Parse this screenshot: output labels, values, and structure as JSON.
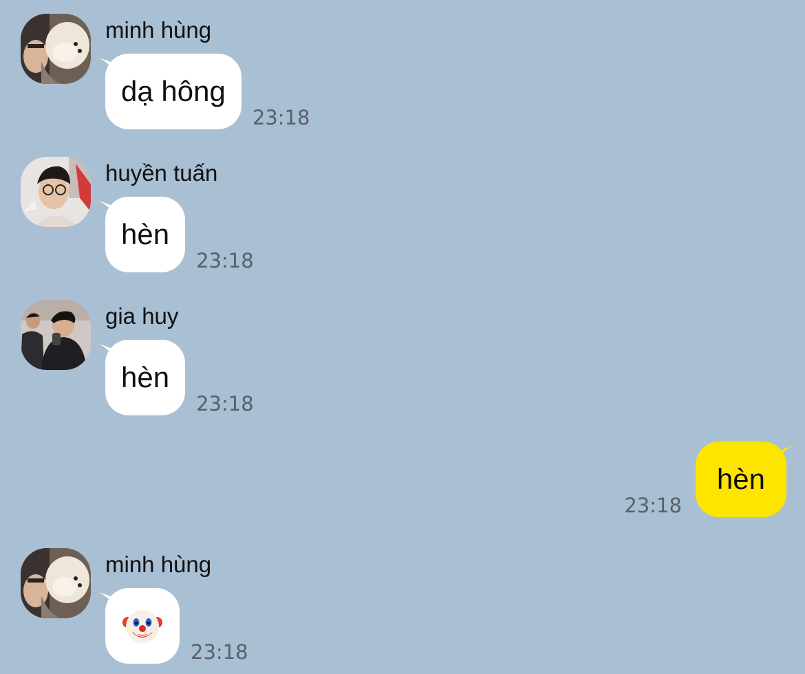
{
  "colors": {
    "background": "#a9bfd3",
    "incoming_bubble": "#ffffff",
    "outgoing_bubble": "#fee500",
    "timestamp": "#59606a"
  },
  "messages": [
    {
      "direction": "incoming",
      "sender": "minh hùng",
      "text": "dạ hông",
      "time": "23:18"
    },
    {
      "direction": "incoming",
      "sender": "huyền tuấn",
      "text": "hèn",
      "time": "23:18"
    },
    {
      "direction": "incoming",
      "sender": "gia huy",
      "text": "hèn",
      "time": "23:18"
    },
    {
      "direction": "outgoing",
      "text": "hèn",
      "time": "23:18"
    },
    {
      "direction": "incoming",
      "sender": "minh hùng",
      "emoji": "clown-face",
      "time": "23:18"
    }
  ]
}
